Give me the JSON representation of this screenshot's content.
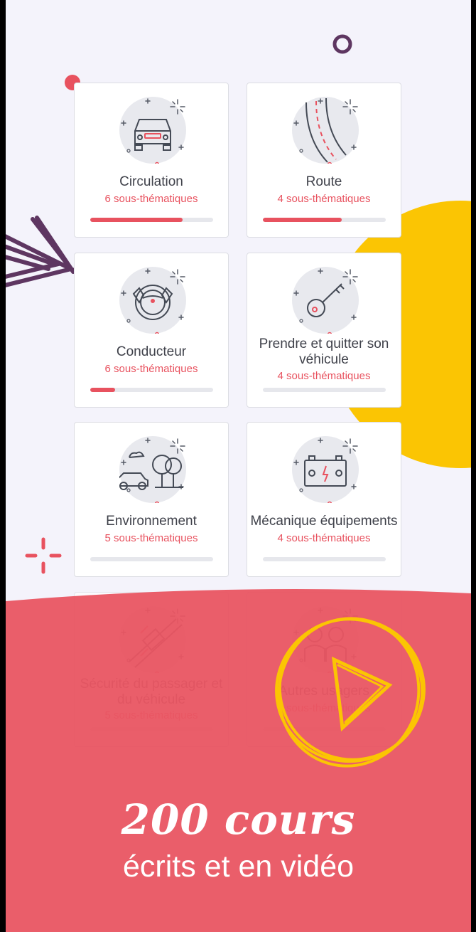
{
  "colors": {
    "accent": "#e8525f",
    "yellow": "#fbc503",
    "purple": "#5e3661",
    "background": "#f4f3fb",
    "text": "#3f414a"
  },
  "categories": [
    {
      "title": "Circulation",
      "subtitle": "6 sous-thématiques",
      "progress": 0.75,
      "icon": "car-front-icon"
    },
    {
      "title": "Route",
      "subtitle": "4 sous-thématiques",
      "progress": 0.64,
      "icon": "road-icon"
    },
    {
      "title": "Conducteur",
      "subtitle": "6 sous-thématiques",
      "progress": 0.2,
      "icon": "steering-wheel-icon"
    },
    {
      "title": "Prendre et quitter son véhicule",
      "subtitle": "4 sous-thématiques",
      "progress": 0,
      "icon": "car-key-icon"
    },
    {
      "title": "Environnement",
      "subtitle": "5 sous-thématiques",
      "progress": 0,
      "icon": "environment-icon"
    },
    {
      "title": "Mécanique équipements",
      "subtitle": "4 sous-thématiques",
      "progress": 0,
      "icon": "battery-icon"
    },
    {
      "title": "Sécurité du passager et du véhicule",
      "subtitle": "5 sous-thématiques",
      "progress": 0,
      "icon": "seatbelt-icon"
    },
    {
      "title": "Autres usagers",
      "subtitle": "5 sous-thématiques",
      "progress": 0,
      "icon": "people-icon"
    }
  ],
  "promo": {
    "headline": "200 cours",
    "subheadline": "écrits et en vidéo"
  }
}
